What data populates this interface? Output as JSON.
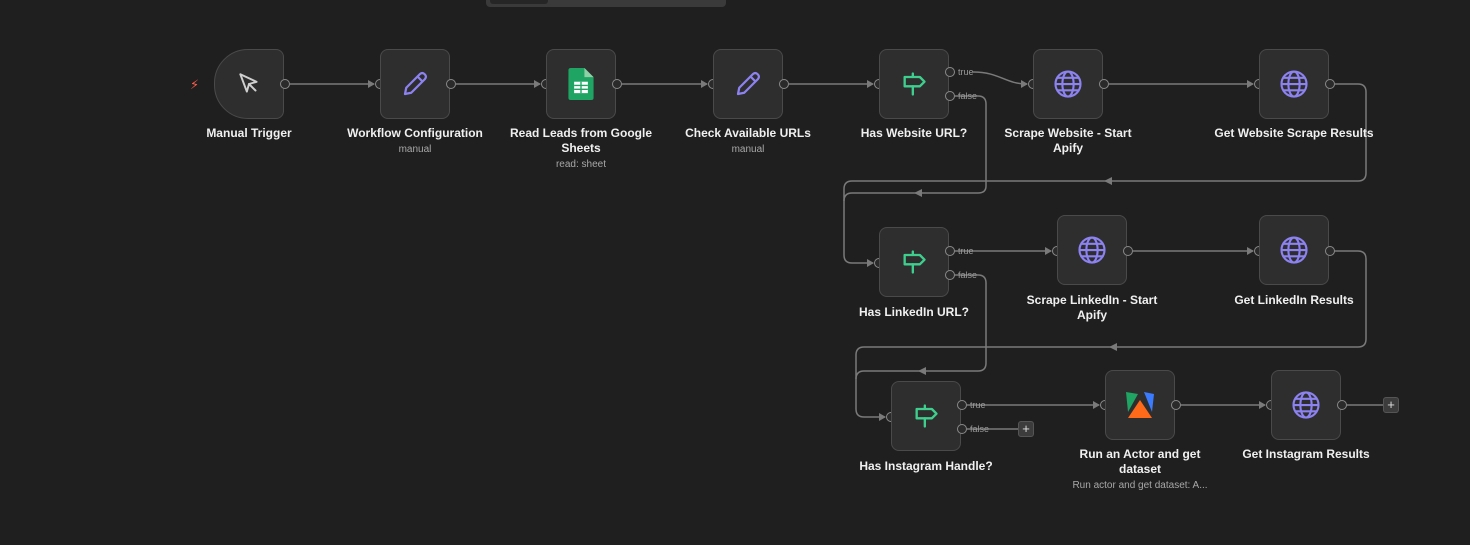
{
  "colors": {
    "background": "#1f1f1f",
    "node": "#2e2e2e",
    "edge": "#7a7a7a",
    "pencil": "#8c82f0",
    "globe": "#8c82f0",
    "if_icon": "#3ecf8e",
    "sheets": "#1fa463",
    "trigger_bolt": "#ff5a4a"
  },
  "nodes": {
    "manual_trigger": {
      "label": "Manual Trigger",
      "icon": "cursor-icon"
    },
    "workflow_config": {
      "label": "Workflow Configuration",
      "sub": "manual",
      "icon": "pencil-icon"
    },
    "read_leads": {
      "label": "Read Leads from Google Sheets",
      "sub": "read: sheet",
      "icon": "google-sheets-icon"
    },
    "check_urls": {
      "label": "Check Available URLs",
      "sub": "manual",
      "icon": "pencil-icon"
    },
    "has_website": {
      "label": "Has Website URL?",
      "icon": "signpost-icon",
      "true_label": "true",
      "false_label": "false"
    },
    "scrape_website": {
      "label": "Scrape Website - Start Apify",
      "icon": "globe-icon"
    },
    "get_website": {
      "label": "Get Website Scrape Results",
      "icon": "globe-icon"
    },
    "has_linkedin": {
      "label": "Has LinkedIn URL?",
      "icon": "signpost-icon",
      "true_label": "true",
      "false_label": "false"
    },
    "scrape_linkedin": {
      "label": "Scrape LinkedIn - Start Apify",
      "icon": "globe-icon"
    },
    "get_linkedin": {
      "label": "Get LinkedIn Results",
      "icon": "globe-icon"
    },
    "has_instagram": {
      "label": "Has Instagram Handle?",
      "icon": "signpost-icon",
      "true_label": "true",
      "false_label": "false"
    },
    "run_actor": {
      "label": "Run an Actor and get dataset",
      "sub": "Run actor and get dataset: A...",
      "icon": "apify-icon"
    },
    "get_instagram": {
      "label": "Get Instagram Results",
      "icon": "globe-icon"
    }
  },
  "plus_label": "+",
  "trigger_bolt": "⚡"
}
